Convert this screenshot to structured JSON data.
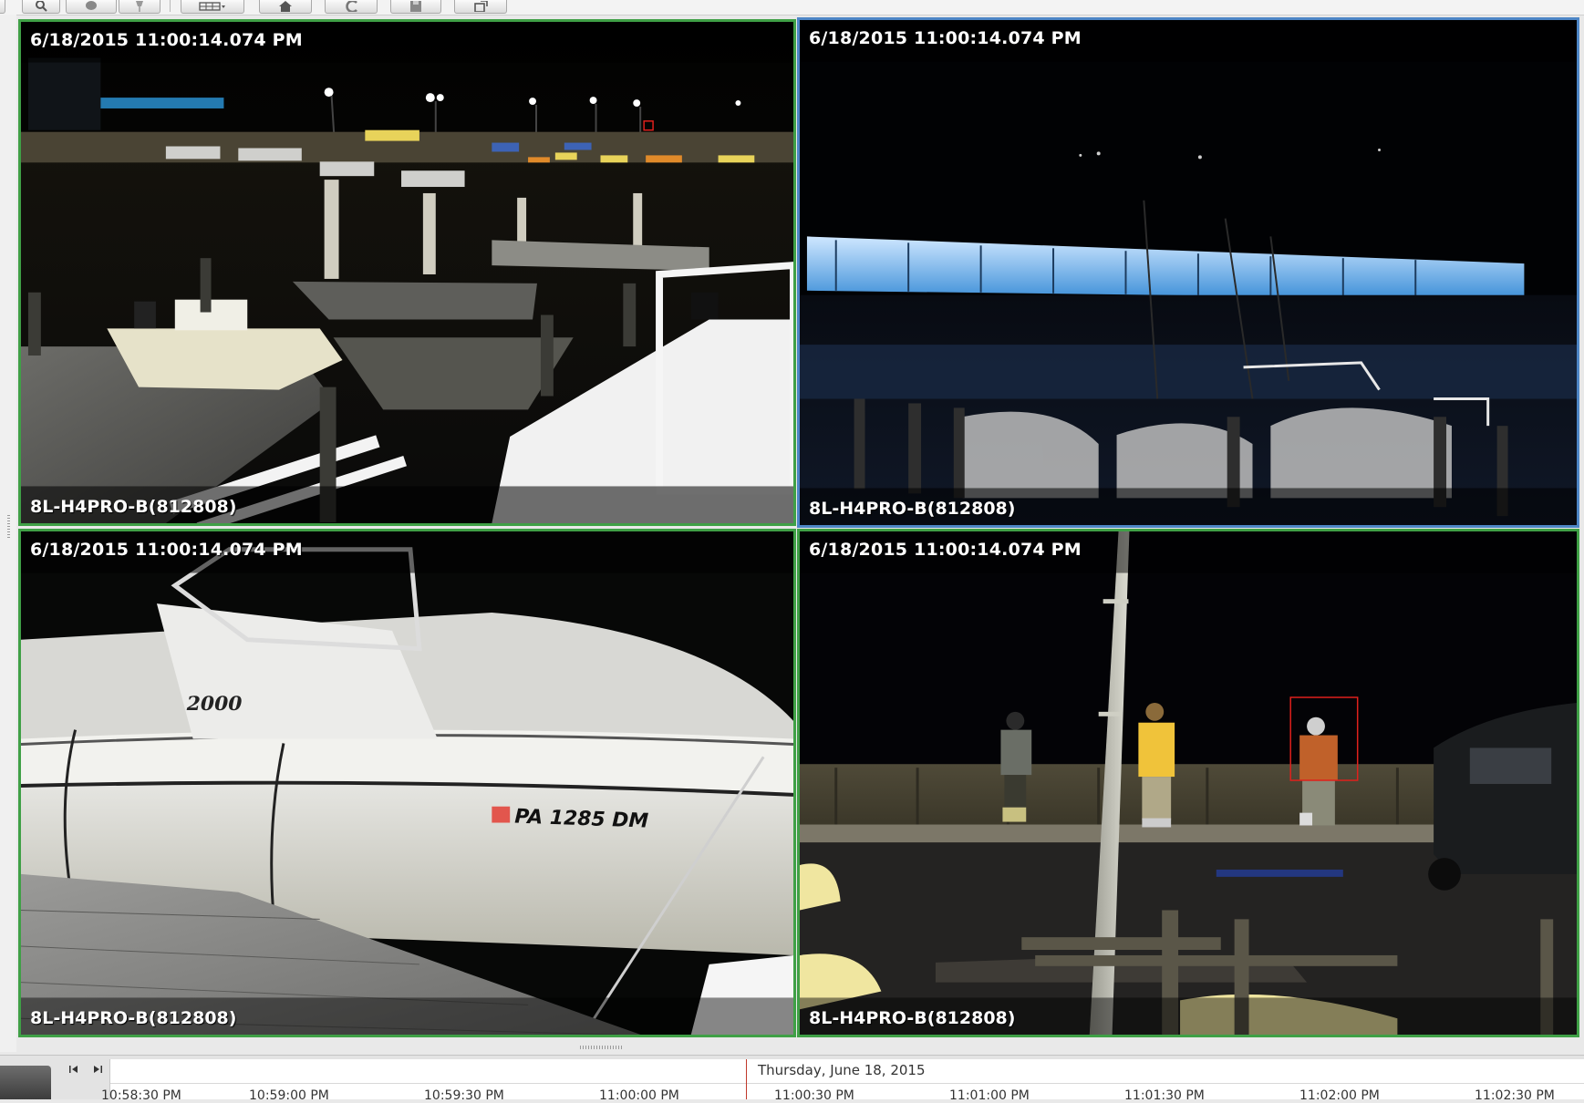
{
  "toolbar": {
    "buttons": [
      {
        "name": "search-icon"
      },
      {
        "name": "motion-icon"
      },
      {
        "name": "pin-icon"
      },
      {
        "name": "layout-grid-icon"
      },
      {
        "name": "home-icon"
      },
      {
        "name": "rewind-icon"
      },
      {
        "name": "save-icon"
      },
      {
        "name": "export-icon"
      }
    ]
  },
  "cameras": [
    {
      "timestamp": "6/18/2015 11:00:14.074 PM",
      "label": "8L-H4PRO-B(812808)",
      "selected": false
    },
    {
      "timestamp": "6/18/2015 11:00:14.074 PM",
      "label": "8L-H4PRO-B(812808)",
      "selected": true
    },
    {
      "timestamp": "6/18/2015 11:00:14.074 PM",
      "label": "8L-H4PRO-B(812808)",
      "selected": false
    },
    {
      "timestamp": "6/18/2015 11:00:14.074 PM",
      "label": "8L-H4PRO-B(812808)",
      "selected": false
    }
  ],
  "boat_registration": "PA 1285 DM",
  "boat_model": "2000",
  "timeline": {
    "date": "Thursday, June 18, 2015",
    "ticks": [
      "10:58:30 PM",
      "10:59:00 PM",
      "10:59:30 PM",
      "11:00:00 PM",
      "11:00:30 PM",
      "11:01:00 PM",
      "11:01:30 PM",
      "11:02:00 PM",
      "11:02:30 PM"
    ]
  },
  "colors": {
    "tile_border": "#3fa046",
    "selected_border": "#4d86c6",
    "timeline_marker": "#c0392b",
    "motion_box": "#e0201c"
  }
}
